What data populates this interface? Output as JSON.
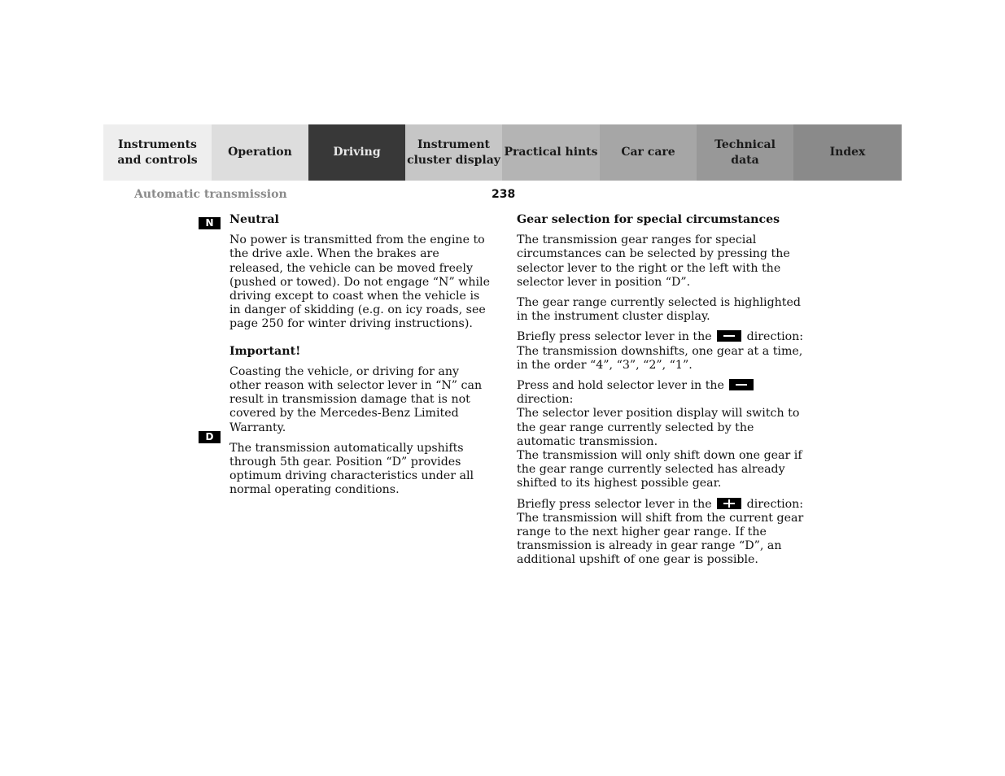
{
  "nav": {
    "tabs": [
      {
        "label": "Instruments\nand controls",
        "bg": "#eeeeee",
        "fg": "#1a1a1a",
        "active": false
      },
      {
        "label": "Operation",
        "bg": "#dddddd",
        "fg": "#1a1a1a",
        "active": false
      },
      {
        "label": "Driving",
        "bg": "#383838",
        "fg": "#e8e8e8",
        "active": true
      },
      {
        "label": "Instrument\ncluster display",
        "bg": "#c6c6c6",
        "fg": "#1a1a1a",
        "active": false
      },
      {
        "label": "Practical hints",
        "bg": "#b4b4b4",
        "fg": "#1a1a1a",
        "active": false
      },
      {
        "label": "Car care",
        "bg": "#a6a6a6",
        "fg": "#1a1a1a",
        "active": false
      },
      {
        "label": "Technical\ndata",
        "bg": "#989898",
        "fg": "#1a1a1a",
        "active": false
      },
      {
        "label": "Index",
        "bg": "#8a8a8a",
        "fg": "#1a1a1a",
        "active": false
      }
    ]
  },
  "header": {
    "section": "Automatic transmission",
    "page_number": "238"
  },
  "left": {
    "neutral": {
      "badge": "N",
      "title": "Neutral",
      "body": "No power is transmitted from the engine to the drive axle. When the brakes are released, the vehicle can be moved freely (pushed or towed). Do not engage “N” while driving except to coast when the vehicle is in danger of skidding (e.g. on icy roads, see page 250 for winter driving instructions)."
    },
    "important": {
      "title": "Important!",
      "body": "Coasting the vehicle, or driving for any other reason with selector lever in “N” can result in transmission damage that is not covered by the Mercedes-Benz Limited Warranty."
    },
    "drive": {
      "badge": "D",
      "body": "The transmission automatically upshifts through 5th gear. Position “D” provides optimum driving characteristics under all normal operating conditions."
    }
  },
  "right": {
    "title": "Gear selection for special circumstances",
    "p1": "The transmission gear ranges for special circumstances can be selected by pressing the selector lever to the right or the left with the selector lever in position “D”.",
    "p2": "The gear range currently selected is highlighted in the instrument cluster display.",
    "p3_pre": "Briefly press selector lever in the",
    "p3_post": "direction:",
    "p3_body": "The transmission downshifts, one gear at a time, in the order “4”, “3”, “2”, “1”.",
    "p4_pre": "Press and hold selector lever in the",
    "p4_post": "direction:",
    "p4_body": "The selector lever position display will switch to the gear range currently selected by the automatic transmission.",
    "p4_body2": "The transmission will only shift down one gear if the gear range currently selected has already shifted to its highest possible gear.",
    "p5_pre": "Briefly press selector lever in the",
    "p5_post": "direction:",
    "p5_body": "The transmission will shift from the current gear range to the next higher gear range. If the transmission is already in gear range “D”, an additional upshift of one gear is possible.",
    "icons": {
      "minus": "minus-key-icon",
      "plus": "plus-key-icon"
    }
  }
}
